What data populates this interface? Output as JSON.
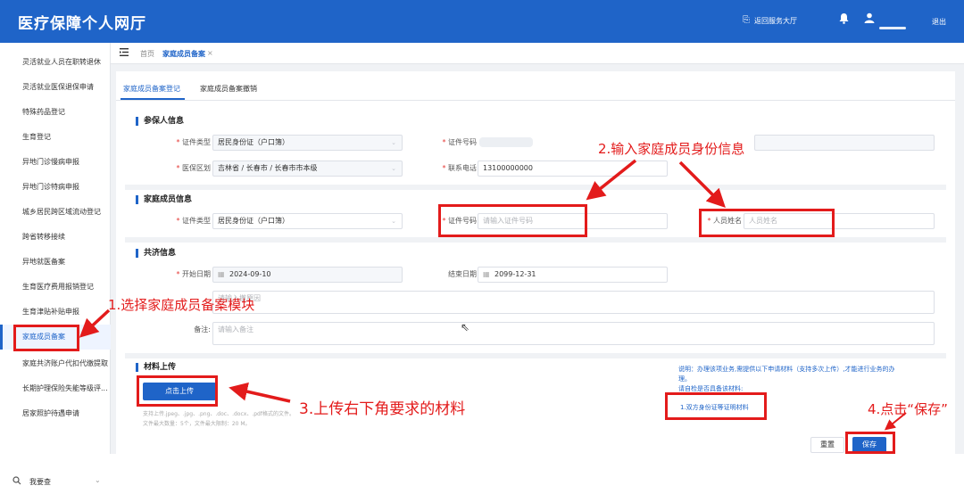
{
  "header": {
    "app_title": "医疗保障个人网厅",
    "return_label": "返回服务大厅",
    "logout_label": "退出"
  },
  "sidebar": {
    "items": [
      "灵活就业人员在职转退休",
      "灵活就业医保退保申请",
      "特殊药品登记",
      "生育登记",
      "异地门诊慢病申报",
      "异地门诊特病申报",
      "城乡居民跨区域流动登记",
      "跨省转移接续",
      "异地就医备案",
      "生育医疗费用报销登记",
      "生育津贴补贴申报",
      "家庭成员备案",
      "家庭共济账户代扣代缴提取",
      "长期护理保险失能等级评...",
      "居家照护待遇申请"
    ],
    "search_label": "我要查"
  },
  "tabs": {
    "home": "首页",
    "current": "家庭成员备案",
    "close": "×"
  },
  "subtabs": [
    "家庭成员备案登记",
    "家庭成员备案撤销"
  ],
  "sections": {
    "insured": "参保人信息",
    "family": "家庭成员信息",
    "mutual": "共济信息",
    "materials": "材料上传"
  },
  "insured": {
    "id_type_label": "证件类型",
    "id_type_value": "居民身份证（户口簿）",
    "id_no_label": "证件号码",
    "region_label": "医保区划",
    "region_value": "吉林省 / 长春市 / 长春市市本级",
    "phone_label": "联系电话",
    "phone_value": "13100000000"
  },
  "family": {
    "id_type_label": "证件类型",
    "id_type_value": "居民身份证（户口簿）",
    "id_no_label": "证件号码",
    "id_no_placeholder": "请输入证件号码",
    "name_label": "人员姓名",
    "name_placeholder": "人员姓名"
  },
  "mutual": {
    "start_label": "开始日期",
    "start_value": "2024-09-10",
    "end_label": "结束日期",
    "end_value": "2099-12-31",
    "reason_placeholder": "请输入撤原因",
    "remark_label": "备注:",
    "remark_placeholder": "请输入备注"
  },
  "upload": {
    "button": "点击上传",
    "hint1": "支持上传.jpeg、.jpg、.png、.doc、.docx、.pdf格式的文件。",
    "hint2": "文件最大数量：5个，文件最大限制：20 M。"
  },
  "notes": {
    "line1": "说明：办理该项业务,需提供以下申请材料（支持多次上传）,才能进行业务的办",
    "line2": "理。",
    "line3": "请自检是否具备该材料:",
    "material1": "1.双方身份证等证明材料"
  },
  "actions": {
    "reset": "重置",
    "save": "保存"
  },
  "annotations": {
    "a1": "1.选择家庭成员备案模块",
    "a2": "2.输入家庭成员身份信息",
    "a3": "3.上传右下角要求的材料",
    "a4": "4.点击“保存”"
  },
  "colors": {
    "primary": "#1f64c8",
    "annotation": "#e31b1b",
    "background": "#f0f2f5"
  }
}
